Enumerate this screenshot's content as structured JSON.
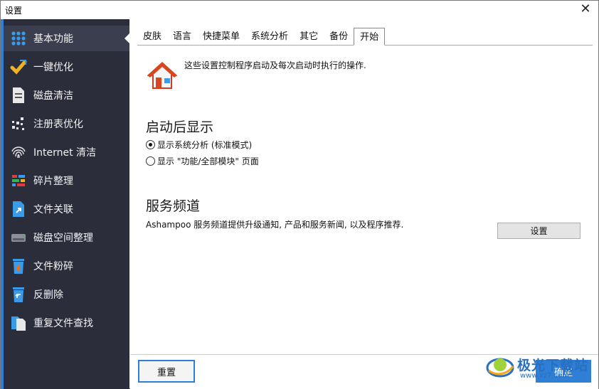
{
  "window": {
    "title": "设置",
    "close_glyph": "✕"
  },
  "sidebar": {
    "items": [
      {
        "label": "基本功能",
        "icon": "grid-dots-icon",
        "active": true
      },
      {
        "label": "一键优化",
        "icon": "magic-wand-icon"
      },
      {
        "label": "磁盘清洁",
        "icon": "disk-file-icon"
      },
      {
        "label": "注册表优化",
        "icon": "registry-dots-icon"
      },
      {
        "label": "Internet 清洁",
        "icon": "fingerprint-icon"
      },
      {
        "label": "碎片整理",
        "icon": "defrag-blocks-icon"
      },
      {
        "label": "文件关联",
        "icon": "file-link-icon"
      },
      {
        "label": "磁盘空间整理",
        "icon": "drive-icon"
      },
      {
        "label": "文件粉碎",
        "icon": "shredder-bin-icon"
      },
      {
        "label": "反删除",
        "icon": "undelete-bin-icon"
      },
      {
        "label": "重复文件查找",
        "icon": "duplicate-files-icon"
      }
    ]
  },
  "tabs": [
    {
      "label": "皮肤"
    },
    {
      "label": "语言"
    },
    {
      "label": "快捷菜单"
    },
    {
      "label": "系统分析"
    },
    {
      "label": "其它"
    },
    {
      "label": "备份"
    },
    {
      "label": "开始",
      "active": true
    }
  ],
  "main": {
    "intro": "这些设置控制程序启动及每次启动时执行的操作.",
    "startup": {
      "title": "启动后显示",
      "options": [
        {
          "label": "显示系统分析 (标准模式)",
          "checked": true
        },
        {
          "label": "显示 \"功能/全部模块\" 页面",
          "checked": false
        }
      ]
    },
    "service": {
      "title": "服务频道",
      "text": "Ashampoo 服务频道提供升级通知, 产品和服务新闻, 以及程序推荐.",
      "button": "设置"
    }
  },
  "footer": {
    "reset": "重置",
    "ok": "确定"
  },
  "watermark": {
    "text": "极光下载站",
    "sub": "www.xz7.com"
  },
  "colors": {
    "accent": "#2f7fd6",
    "sidebar_bg": "#2b2d3a",
    "sidebar_active": "#3b3e4e"
  }
}
